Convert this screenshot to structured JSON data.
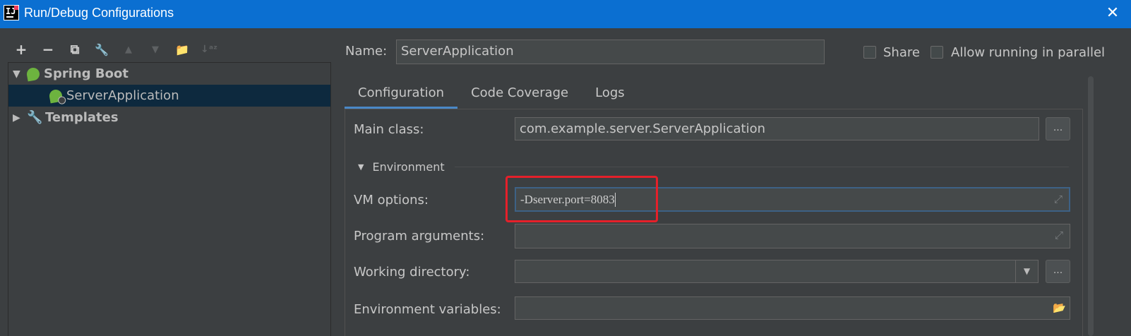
{
  "window": {
    "title": "Run/Debug Configurations",
    "icon_text": "IJ",
    "close_glyph": "✕"
  },
  "toolbar": {
    "buttons": [
      {
        "name": "add",
        "glyph": "+",
        "enabled": true
      },
      {
        "name": "remove",
        "glyph": "−",
        "enabled": true
      },
      {
        "name": "copy",
        "glyph": "⧉",
        "enabled": true
      },
      {
        "name": "edit-defaults",
        "glyph": "🔧",
        "enabled": true
      },
      {
        "name": "move-up",
        "glyph": "▲",
        "enabled": false
      },
      {
        "name": "move-down",
        "glyph": "▼",
        "enabled": false
      },
      {
        "name": "new-folder",
        "glyph": "📁",
        "enabled": true
      },
      {
        "name": "sort",
        "glyph": "↓ᵃᶻ",
        "enabled": false
      }
    ]
  },
  "tree": {
    "items": [
      {
        "label": "Spring Boot",
        "expanded": true,
        "icon": "spring-icon",
        "bold": true
      },
      {
        "label": "ServerApplication",
        "icon": "spring-app-icon",
        "selected": true
      },
      {
        "label": "Templates",
        "expanded": false,
        "icon": "wrench-icon",
        "bold": true
      }
    ]
  },
  "header": {
    "name_label": "Name:",
    "name_value": "ServerApplication",
    "share_label": "Share",
    "share_checked": false,
    "parallel_label": "Allow running in parallel",
    "parallel_checked": false
  },
  "tabs": [
    {
      "label": "Configuration",
      "active": true
    },
    {
      "label": "Code Coverage",
      "active": false
    },
    {
      "label": "Logs",
      "active": false
    }
  ],
  "form": {
    "main_class_label": "Main class:",
    "main_class_value": "com.example.server.ServerApplication",
    "browse_label": "...",
    "environment_label": "Environment",
    "vm_options_label": "VM options:",
    "vm_options_value": "-Dserver.port=8083",
    "program_args_label": "Program arguments:",
    "program_args_value": "",
    "working_dir_label": "Working directory:",
    "working_dir_value": "",
    "env_vars_label": "Environment variables:",
    "env_vars_value": ""
  },
  "colors": {
    "titlebar": "#0b6fd1",
    "background": "#3c3f41",
    "selection": "#0d293e",
    "accent_tab": "#4a88c7",
    "highlight_box": "#e5202a"
  }
}
